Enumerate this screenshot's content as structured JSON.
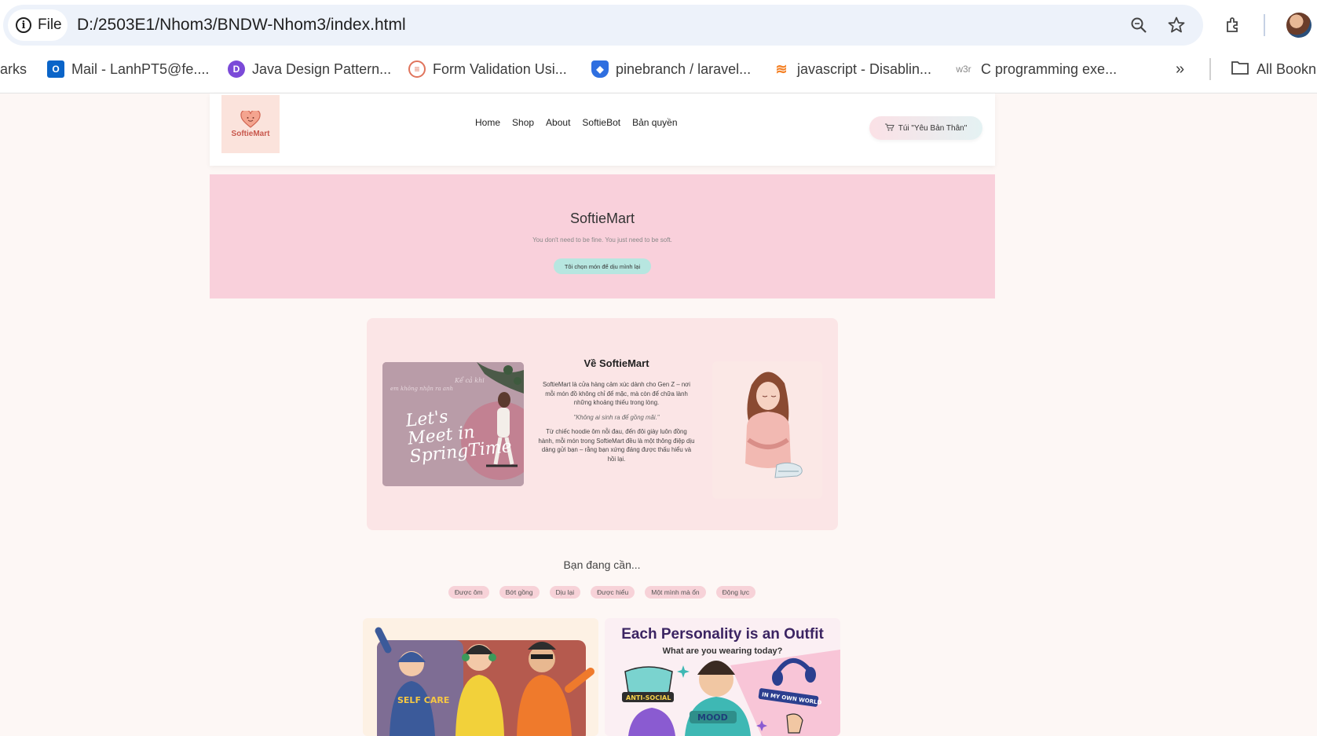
{
  "browser": {
    "file_label": "File",
    "url": "D:/2503E1/Nhom3/BNDW-Nhom3/index.html",
    "bookmarks_partial_left": "arks",
    "bookmarks": [
      {
        "label": "Mail - LanhPT5@fe....",
        "icon": "outlook-icon"
      },
      {
        "label": "Java Design Pattern...",
        "icon": "jd-icon"
      },
      {
        "label": "Form Validation Usi...",
        "icon": "form-icon"
      },
      {
        "label": "pinebranch / laravel...",
        "icon": "shield-icon"
      },
      {
        "label": "javascript - Disablin...",
        "icon": "stackoverflow-icon"
      },
      {
        "label": "C programming exe...",
        "icon": "w3r-icon"
      }
    ],
    "overflow_label": "»",
    "all_bookmarks_label": "All Bookn",
    "w3r_icon_text": "w3r"
  },
  "site": {
    "logo_text": "SoftieMart",
    "nav": [
      "Home",
      "Shop",
      "About",
      "SoftieBot",
      "Bản quyền"
    ],
    "bag_label": "Túi \"Yêu Bản Thân\"",
    "hero": {
      "title": "SoftieMart",
      "subtitle": "You don't need to be fine. You just need to be soft.",
      "button": "Tôi chọn món để dịu mình lại"
    },
    "about": {
      "title": "Về SoftieMart",
      "p1": "SoftieMart là cửa hàng cảm xúc dành cho Gen Z – nơi mỗi món đồ không chỉ để mặc, mà còn để chữa lành những khoảng thiếu trong lòng.",
      "quote": "\"Không ai sinh ra để gồng mãi.\"",
      "p2": "Từ chiếc hoodie ôm nỗi đau, đến đôi giày luôn đồng hành, mỗi món trong SoftieMart đều là một thông điệp dịu dàng gửi bạn – rằng bạn xứng đáng được thấu hiểu và hồi lại.",
      "image_text_1": "Kể cả khi",
      "image_text_2": "em không nhận ra anh",
      "image_script": "Let's Meet in SpringTime"
    },
    "need_title": "Bạn đang cần...",
    "tags": [
      "Được ôm",
      "Bớt gồng",
      "Dịu lại",
      "Được hiểu",
      "Một mình mà ổn",
      "Động lực"
    ],
    "cards": {
      "card1_badge": "SELF CARE",
      "card2_title": "Each Personality is an Outfit",
      "card2_sub": "What are you wearing today?",
      "card2_badge1": "ANTI-SOCIAL",
      "card2_badge2": "IN MY OWN WORLD",
      "card2_badge3": "MOOD"
    }
  },
  "colors": {
    "hero_bg": "#f9d0db",
    "about_bg": "#fbe5e6",
    "tag_bg": "#f7d2d8",
    "accent_teal": "#b7e6e0",
    "brand": "#c8574c"
  }
}
